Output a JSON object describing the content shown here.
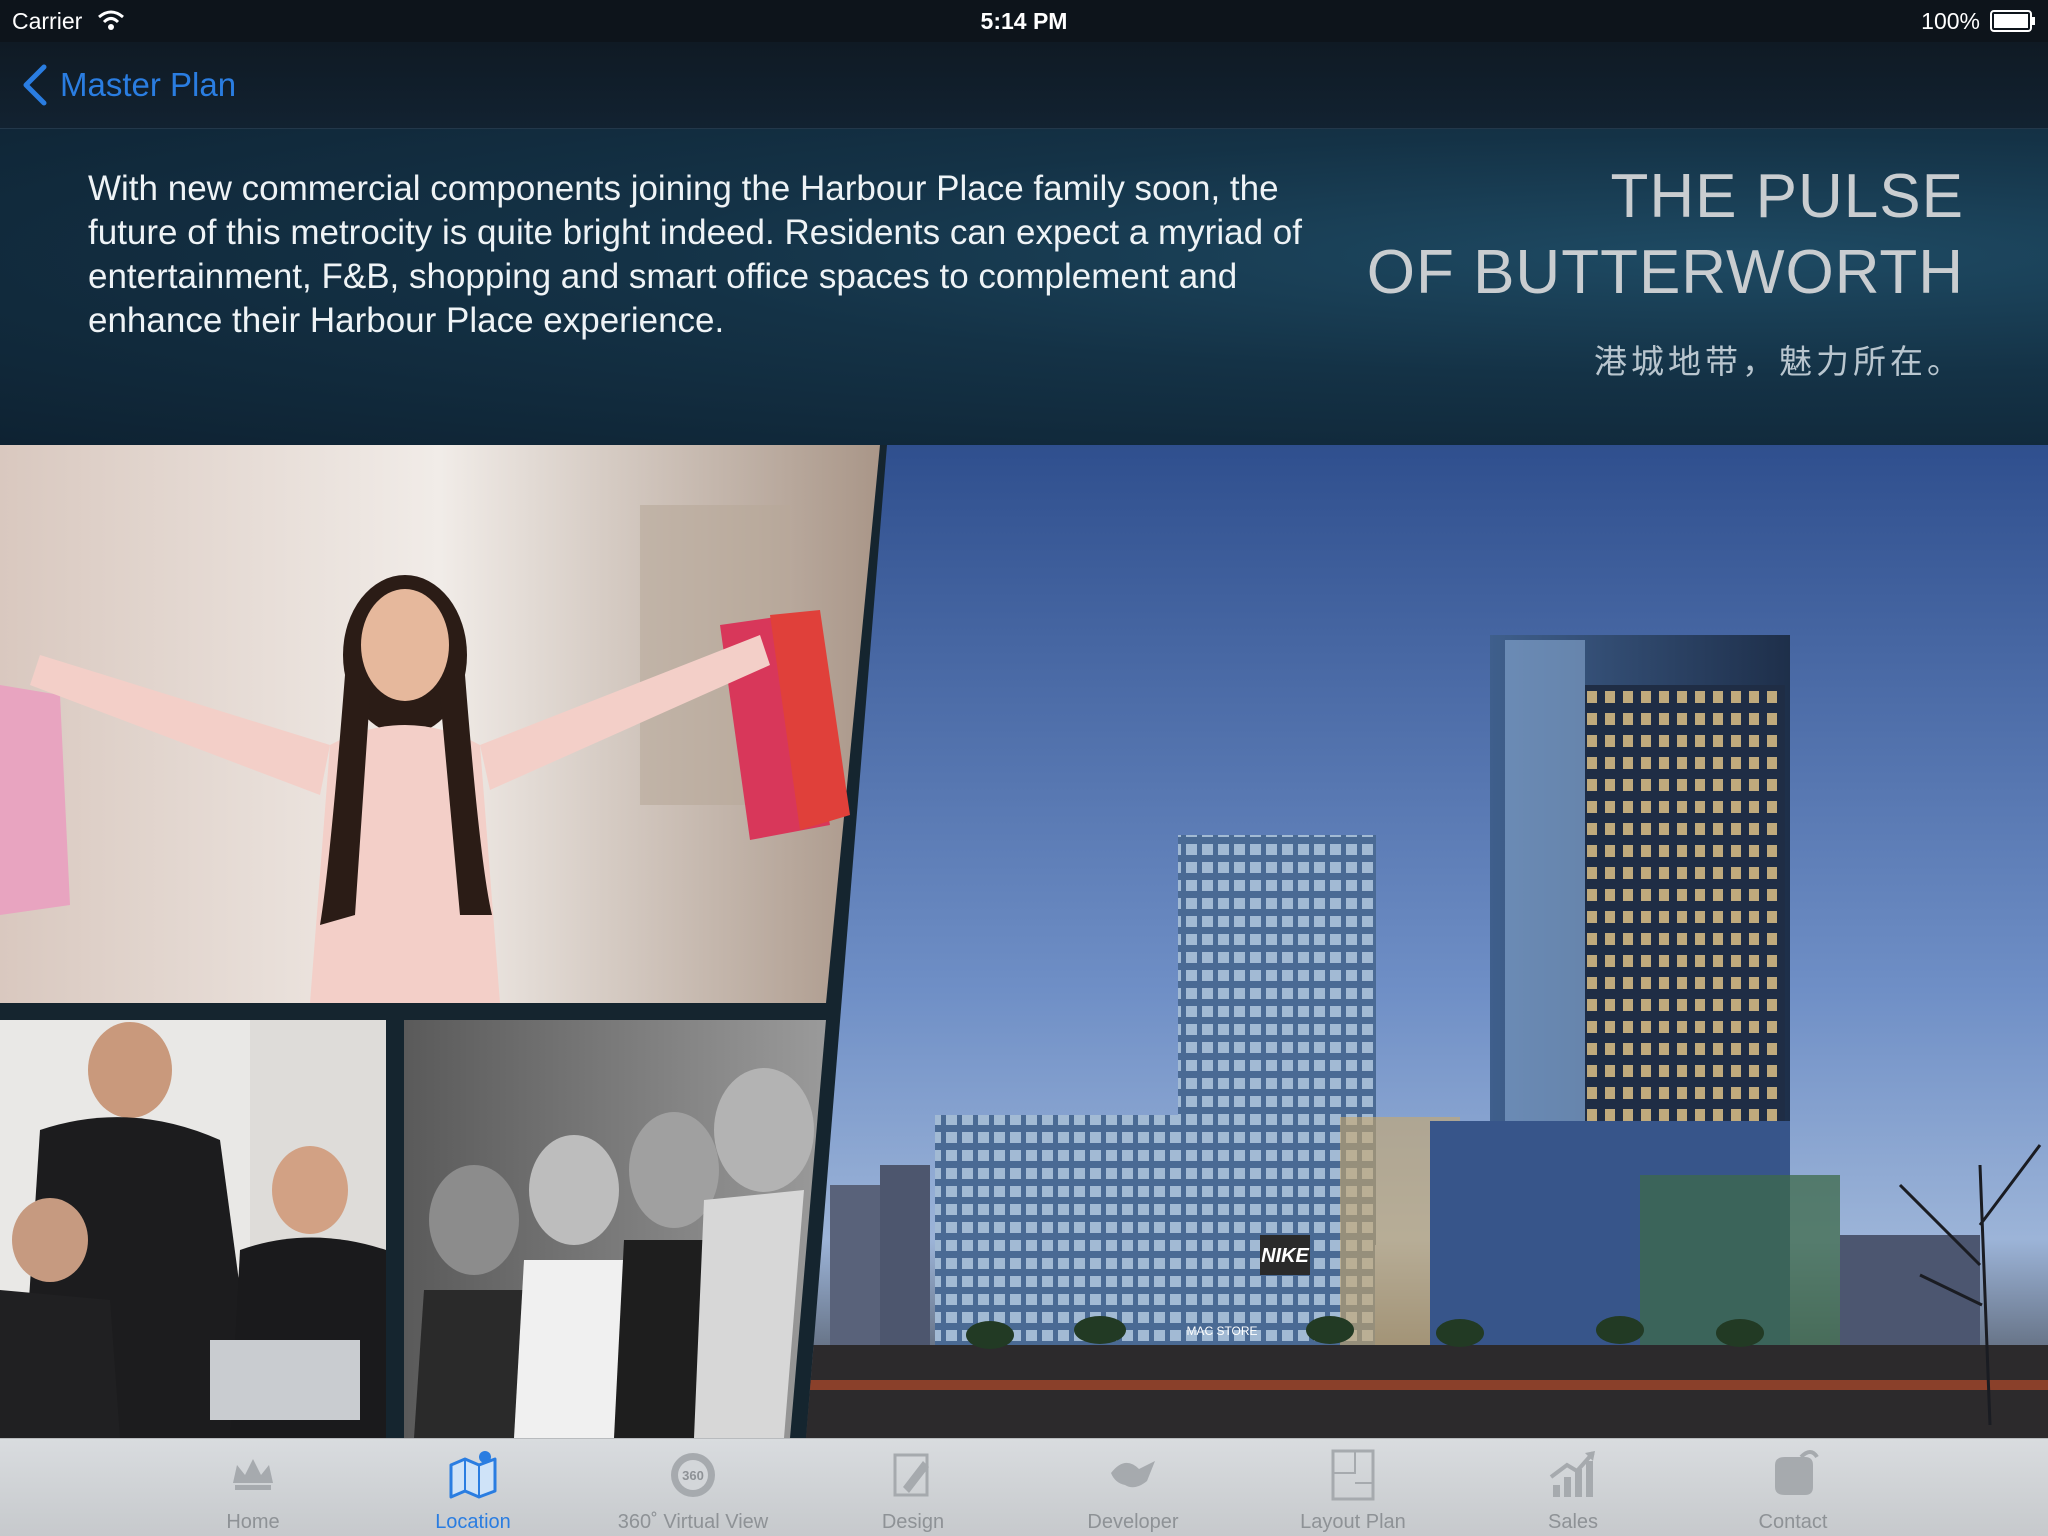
{
  "status_bar": {
    "carrier": "Carrier",
    "time": "5:14 PM",
    "battery": "100%"
  },
  "nav": {
    "back_label": "Master Plan"
  },
  "intro": {
    "paragraph": "With new commercial components joining the Harbour Place family soon, the future of this metrocity is quite bright indeed. Residents can expect a myriad of entertainment, F&B, shopping and smart office spaces to complement and enhance their Harbour Place experience.",
    "tagline_line1": "THE PULSE",
    "tagline_line2": "OF BUTTERWORTH",
    "tagline_cn": "港城地带，魅力所在。"
  },
  "building_signs": {
    "nike": "NIKE",
    "mac_store": "MAC STORE"
  },
  "tabs": [
    {
      "label": "Home",
      "icon": "crown-icon",
      "active": false
    },
    {
      "label": "Location",
      "icon": "map-icon",
      "active": true
    },
    {
      "label": "360˚ Virtual View",
      "icon": "360-view-icon",
      "active": false
    },
    {
      "label": "Design",
      "icon": "design-icon",
      "active": false
    },
    {
      "label": "Developer",
      "icon": "developer-icon",
      "active": false
    },
    {
      "label": "Layout Plan",
      "icon": "layout-plan-icon",
      "active": false
    },
    {
      "label": "Sales",
      "icon": "sales-chart-icon",
      "active": false
    },
    {
      "label": "Contact",
      "icon": "contact-icon",
      "active": false
    }
  ],
  "colors": {
    "accent": "#2a7de1",
    "tab_inactive": "#8e9296",
    "panel": "#143246"
  }
}
